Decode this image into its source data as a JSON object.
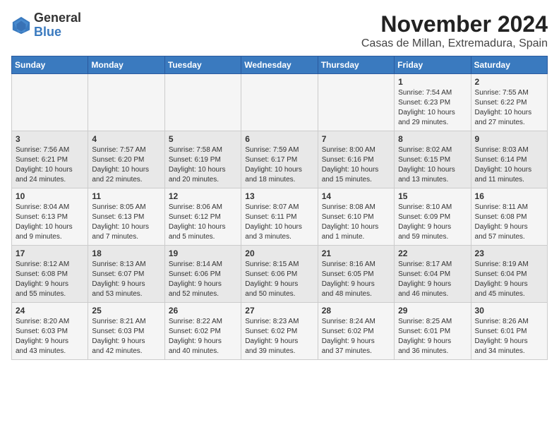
{
  "header": {
    "logo_line1": "General",
    "logo_line2": "Blue",
    "month_title": "November 2024",
    "subtitle": "Casas de Millan, Extremadura, Spain"
  },
  "days_of_week": [
    "Sunday",
    "Monday",
    "Tuesday",
    "Wednesday",
    "Thursday",
    "Friday",
    "Saturday"
  ],
  "weeks": [
    [
      {
        "day": "",
        "info": ""
      },
      {
        "day": "",
        "info": ""
      },
      {
        "day": "",
        "info": ""
      },
      {
        "day": "",
        "info": ""
      },
      {
        "day": "",
        "info": ""
      },
      {
        "day": "1",
        "info": "Sunrise: 7:54 AM\nSunset: 6:23 PM\nDaylight: 10 hours\nand 29 minutes."
      },
      {
        "day": "2",
        "info": "Sunrise: 7:55 AM\nSunset: 6:22 PM\nDaylight: 10 hours\nand 27 minutes."
      }
    ],
    [
      {
        "day": "3",
        "info": "Sunrise: 7:56 AM\nSunset: 6:21 PM\nDaylight: 10 hours\nand 24 minutes."
      },
      {
        "day": "4",
        "info": "Sunrise: 7:57 AM\nSunset: 6:20 PM\nDaylight: 10 hours\nand 22 minutes."
      },
      {
        "day": "5",
        "info": "Sunrise: 7:58 AM\nSunset: 6:19 PM\nDaylight: 10 hours\nand 20 minutes."
      },
      {
        "day": "6",
        "info": "Sunrise: 7:59 AM\nSunset: 6:17 PM\nDaylight: 10 hours\nand 18 minutes."
      },
      {
        "day": "7",
        "info": "Sunrise: 8:00 AM\nSunset: 6:16 PM\nDaylight: 10 hours\nand 15 minutes."
      },
      {
        "day": "8",
        "info": "Sunrise: 8:02 AM\nSunset: 6:15 PM\nDaylight: 10 hours\nand 13 minutes."
      },
      {
        "day": "9",
        "info": "Sunrise: 8:03 AM\nSunset: 6:14 PM\nDaylight: 10 hours\nand 11 minutes."
      }
    ],
    [
      {
        "day": "10",
        "info": "Sunrise: 8:04 AM\nSunset: 6:13 PM\nDaylight: 10 hours\nand 9 minutes."
      },
      {
        "day": "11",
        "info": "Sunrise: 8:05 AM\nSunset: 6:13 PM\nDaylight: 10 hours\nand 7 minutes."
      },
      {
        "day": "12",
        "info": "Sunrise: 8:06 AM\nSunset: 6:12 PM\nDaylight: 10 hours\nand 5 minutes."
      },
      {
        "day": "13",
        "info": "Sunrise: 8:07 AM\nSunset: 6:11 PM\nDaylight: 10 hours\nand 3 minutes."
      },
      {
        "day": "14",
        "info": "Sunrise: 8:08 AM\nSunset: 6:10 PM\nDaylight: 10 hours\nand 1 minute."
      },
      {
        "day": "15",
        "info": "Sunrise: 8:10 AM\nSunset: 6:09 PM\nDaylight: 9 hours\nand 59 minutes."
      },
      {
        "day": "16",
        "info": "Sunrise: 8:11 AM\nSunset: 6:08 PM\nDaylight: 9 hours\nand 57 minutes."
      }
    ],
    [
      {
        "day": "17",
        "info": "Sunrise: 8:12 AM\nSunset: 6:08 PM\nDaylight: 9 hours\nand 55 minutes."
      },
      {
        "day": "18",
        "info": "Sunrise: 8:13 AM\nSunset: 6:07 PM\nDaylight: 9 hours\nand 53 minutes."
      },
      {
        "day": "19",
        "info": "Sunrise: 8:14 AM\nSunset: 6:06 PM\nDaylight: 9 hours\nand 52 minutes."
      },
      {
        "day": "20",
        "info": "Sunrise: 8:15 AM\nSunset: 6:06 PM\nDaylight: 9 hours\nand 50 minutes."
      },
      {
        "day": "21",
        "info": "Sunrise: 8:16 AM\nSunset: 6:05 PM\nDaylight: 9 hours\nand 48 minutes."
      },
      {
        "day": "22",
        "info": "Sunrise: 8:17 AM\nSunset: 6:04 PM\nDaylight: 9 hours\nand 46 minutes."
      },
      {
        "day": "23",
        "info": "Sunrise: 8:19 AM\nSunset: 6:04 PM\nDaylight: 9 hours\nand 45 minutes."
      }
    ],
    [
      {
        "day": "24",
        "info": "Sunrise: 8:20 AM\nSunset: 6:03 PM\nDaylight: 9 hours\nand 43 minutes."
      },
      {
        "day": "25",
        "info": "Sunrise: 8:21 AM\nSunset: 6:03 PM\nDaylight: 9 hours\nand 42 minutes."
      },
      {
        "day": "26",
        "info": "Sunrise: 8:22 AM\nSunset: 6:02 PM\nDaylight: 9 hours\nand 40 minutes."
      },
      {
        "day": "27",
        "info": "Sunrise: 8:23 AM\nSunset: 6:02 PM\nDaylight: 9 hours\nand 39 minutes."
      },
      {
        "day": "28",
        "info": "Sunrise: 8:24 AM\nSunset: 6:02 PM\nDaylight: 9 hours\nand 37 minutes."
      },
      {
        "day": "29",
        "info": "Sunrise: 8:25 AM\nSunset: 6:01 PM\nDaylight: 9 hours\nand 36 minutes."
      },
      {
        "day": "30",
        "info": "Sunrise: 8:26 AM\nSunset: 6:01 PM\nDaylight: 9 hours\nand 34 minutes."
      }
    ]
  ]
}
